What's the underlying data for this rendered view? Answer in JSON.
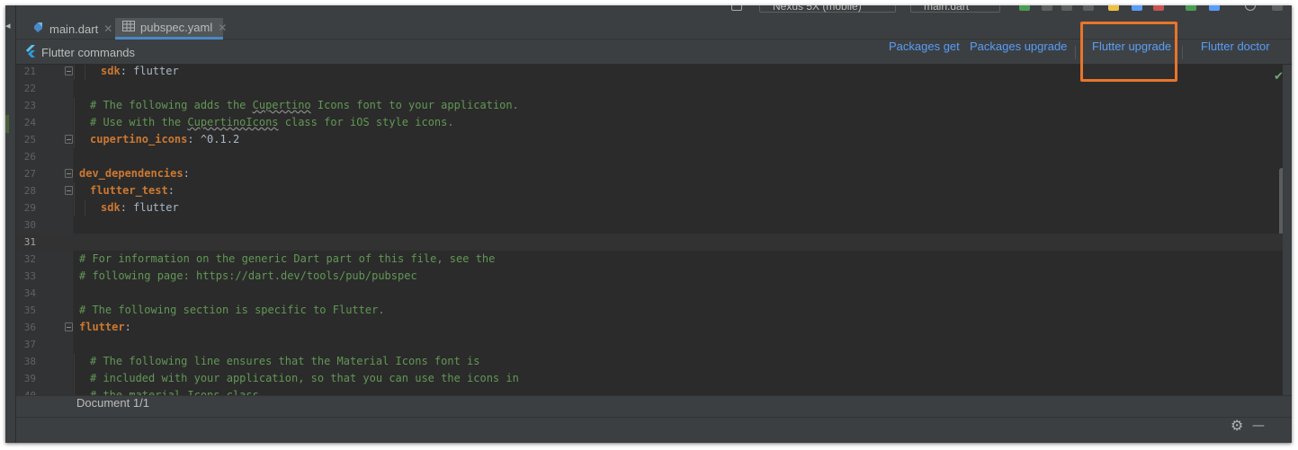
{
  "toolbar": {
    "device": "Nexus 5X (mobile)",
    "config": "main.dart"
  },
  "tabs": [
    {
      "label": "main.dart",
      "icon": "dart-file-icon",
      "active": false
    },
    {
      "label": "pubspec.yaml",
      "icon": "table-file-icon",
      "active": true
    }
  ],
  "commands": {
    "title": "Flutter commands",
    "packages_get": "Packages get",
    "packages_upgrade": "Packages upgrade",
    "flutter_upgrade": "Flutter upgrade",
    "flutter_doctor": "Flutter doctor"
  },
  "editor": {
    "current_line": 31,
    "lines": [
      {
        "n": 21,
        "fold": true,
        "indent": 2,
        "parts": [
          {
            "t": "k",
            "s": "sdk"
          },
          {
            "t": "v",
            "s": ": flutter"
          }
        ]
      },
      {
        "n": 22,
        "fold": false,
        "indent": 0,
        "parts": []
      },
      {
        "n": 23,
        "fold": false,
        "indent": 1,
        "parts": [
          {
            "t": "c",
            "s": "# The following adds the "
          },
          {
            "t": "cu",
            "s": "Cupertino"
          },
          {
            "t": "c",
            "s": " Icons font to your application."
          }
        ]
      },
      {
        "n": 24,
        "fold": false,
        "indent": 1,
        "parts": [
          {
            "t": "c",
            "s": "# Use with the "
          },
          {
            "t": "cu",
            "s": "CupertinoIcons"
          },
          {
            "t": "c",
            "s": " class for iOS style icons."
          }
        ]
      },
      {
        "n": 25,
        "fold": true,
        "indent": 1,
        "parts": [
          {
            "t": "k",
            "s": "cupertino_icons"
          },
          {
            "t": "v",
            "s": ": ^0.1.2"
          }
        ]
      },
      {
        "n": 26,
        "fold": false,
        "indent": 0,
        "parts": []
      },
      {
        "n": 27,
        "fold": true,
        "indent": 0,
        "parts": [
          {
            "t": "k",
            "s": "dev_dependencies"
          },
          {
            "t": "v",
            "s": ":"
          }
        ]
      },
      {
        "n": 28,
        "fold": true,
        "indent": 1,
        "parts": [
          {
            "t": "k",
            "s": "flutter_test"
          },
          {
            "t": "v",
            "s": ":"
          }
        ]
      },
      {
        "n": 29,
        "fold": false,
        "indent": 2,
        "parts": [
          {
            "t": "k",
            "s": "sdk"
          },
          {
            "t": "v",
            "s": ": flutter"
          }
        ]
      },
      {
        "n": 30,
        "fold": false,
        "indent": 0,
        "parts": []
      },
      {
        "n": 31,
        "fold": false,
        "indent": 0,
        "parts": []
      },
      {
        "n": 32,
        "fold": false,
        "indent": 0,
        "parts": [
          {
            "t": "c",
            "s": "# For information on the generic Dart part of this file, see the"
          }
        ]
      },
      {
        "n": 33,
        "fold": false,
        "indent": 0,
        "parts": [
          {
            "t": "c",
            "s": "# following page: https://dart.dev/tools/pub/pubspec"
          }
        ]
      },
      {
        "n": 34,
        "fold": false,
        "indent": 0,
        "parts": []
      },
      {
        "n": 35,
        "fold": false,
        "indent": 0,
        "parts": [
          {
            "t": "c",
            "s": "# The following section is specific to Flutter."
          }
        ]
      },
      {
        "n": 36,
        "fold": true,
        "indent": 0,
        "parts": [
          {
            "t": "k",
            "s": "flutter"
          },
          {
            "t": "v",
            "s": ":"
          }
        ]
      },
      {
        "n": 37,
        "fold": false,
        "indent": 0,
        "parts": []
      },
      {
        "n": 38,
        "fold": false,
        "indent": 1,
        "parts": [
          {
            "t": "c",
            "s": "# The following line ensures that the Material Icons font is"
          }
        ]
      },
      {
        "n": 39,
        "fold": false,
        "indent": 1,
        "parts": [
          {
            "t": "c",
            "s": "# included with your application, so that you can use the icons in"
          }
        ]
      },
      {
        "n": 40,
        "fold": false,
        "indent": 1,
        "parts": [
          {
            "t": "c",
            "s": "# the material Icons class."
          }
        ]
      }
    ]
  },
  "status": {
    "document": "Document 1/1"
  }
}
